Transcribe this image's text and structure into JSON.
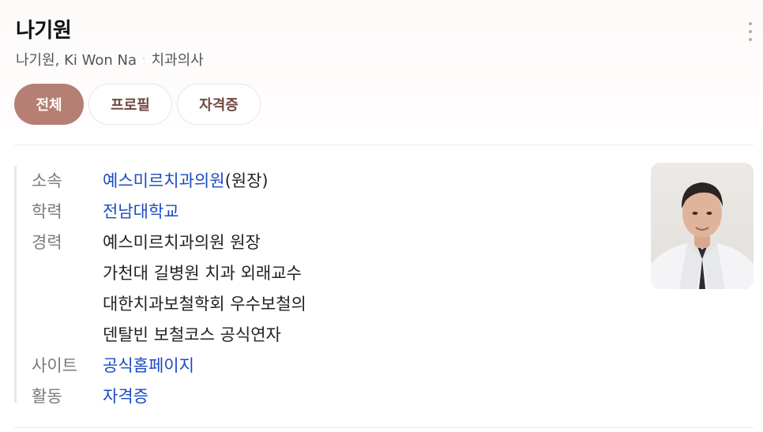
{
  "profile": {
    "name": "나기원",
    "alt_name": "나기원, Ki Won Na",
    "separator": "·",
    "occupation": "치과의사"
  },
  "tabs": [
    {
      "label": "전체",
      "active": true
    },
    {
      "label": "프로필",
      "active": false
    },
    {
      "label": "자격증",
      "active": false
    }
  ],
  "info": {
    "affiliation_label": "소속",
    "affiliation_link": "예스미르치과의원",
    "affiliation_role": "(원장)",
    "education_label": "학력",
    "education_value": "전남대학교",
    "career_label": "경력",
    "career": [
      "예스미르치과의원 원장",
      "가천대 길병원 치과 외래교수",
      "대한치과보철학회 우수보철의",
      "덴탈빈 보철코스 공식연자"
    ],
    "site_label": "사이트",
    "site_value": "공식홈페이지",
    "activity_label": "활동",
    "activity_value": "자격증"
  },
  "icons": {
    "more": "more-vertical-icon"
  },
  "colors": {
    "accent": "#b57f73",
    "link": "#1a4bc4",
    "label": "#7a7a7a"
  }
}
